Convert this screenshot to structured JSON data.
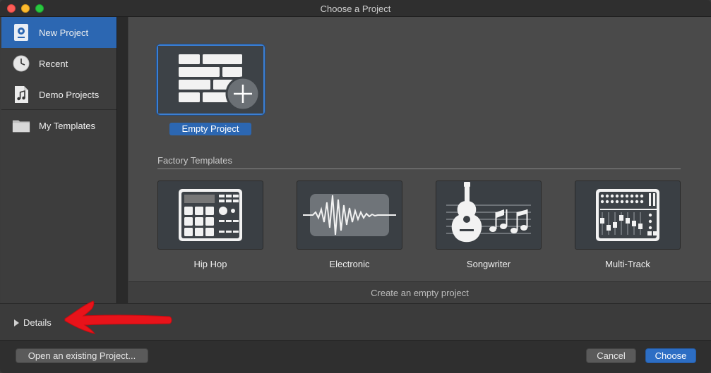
{
  "window": {
    "title": "Choose a Project"
  },
  "sidebar": {
    "items": [
      {
        "label": "New Project",
        "icon": "new-project-icon",
        "selected": true
      },
      {
        "label": "Recent",
        "icon": "clock-icon",
        "selected": false
      },
      {
        "label": "Demo Projects",
        "icon": "music-document-icon",
        "selected": false
      },
      {
        "label": "My Templates",
        "icon": "folder-icon",
        "selected": false
      }
    ]
  },
  "main": {
    "empty_project_label": "Empty Project",
    "section_title": "Factory Templates",
    "templates": [
      {
        "label": "Hip Hop",
        "icon": "drum-machine-icon"
      },
      {
        "label": "Electronic",
        "icon": "waveform-icon"
      },
      {
        "label": "Songwriter",
        "icon": "guitar-notes-icon"
      },
      {
        "label": "Multi-Track",
        "icon": "mixer-icon"
      }
    ],
    "status_text": "Create an empty project"
  },
  "details": {
    "label": "Details"
  },
  "footer": {
    "open_existing_label": "Open an existing Project...",
    "cancel_label": "Cancel",
    "choose_label": "Choose"
  },
  "colors": {
    "accent": "#2c67b2",
    "annotation_arrow": "#e8131a"
  }
}
